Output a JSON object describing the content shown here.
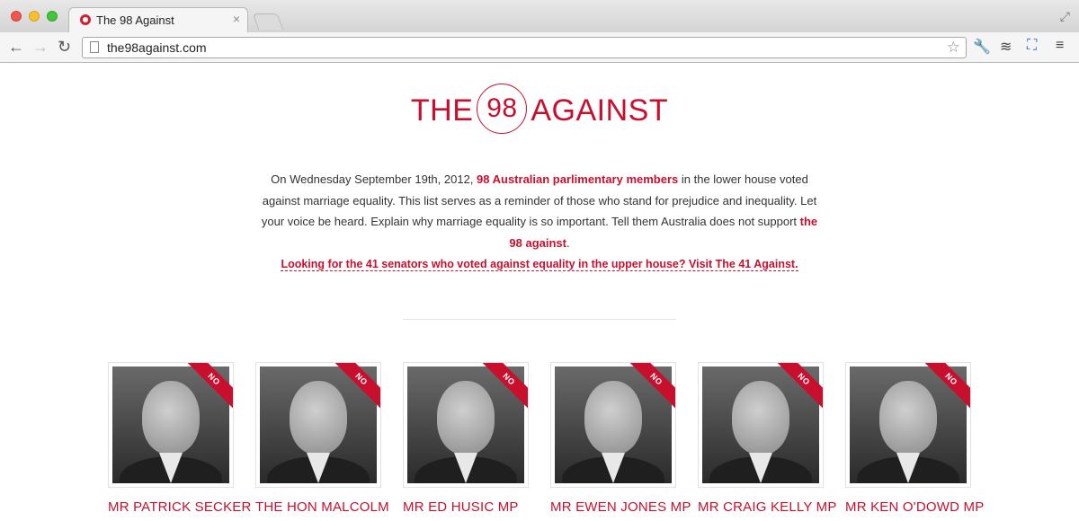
{
  "browser": {
    "tab_title": "The 98 Against",
    "url": "the98against.com"
  },
  "logo": {
    "left": "THE",
    "number": "98",
    "right": "AGAINST"
  },
  "intro": {
    "part1": "On Wednesday September 19th, 2012, ",
    "link1": "98 Australian parlimentary members",
    "part2": " in the lower house voted against marriage equality. This list serves as a reminder of those who stand for prejudice and inequality. Let your voice be heard. Explain why marriage equality is so important. Tell them Australia does not support ",
    "link2": "the 98 against",
    "part3": "."
  },
  "senators_link": "Looking for the 41 senators who voted against equality in the upper house? Visit The 41 Against.",
  "members": [
    {
      "name": "MR PATRICK SECKER",
      "vote": "NO"
    },
    {
      "name": "THE HON MALCOLM",
      "vote": "NO"
    },
    {
      "name": "MR ED HUSIC MP",
      "vote": "NO"
    },
    {
      "name": "MR EWEN JONES MP",
      "vote": "NO"
    },
    {
      "name": "MR CRAIG KELLY MP",
      "vote": "NO"
    },
    {
      "name": "MR KEN O'DOWD MP",
      "vote": "NO"
    }
  ],
  "colors": {
    "accent": "#c8102e"
  }
}
